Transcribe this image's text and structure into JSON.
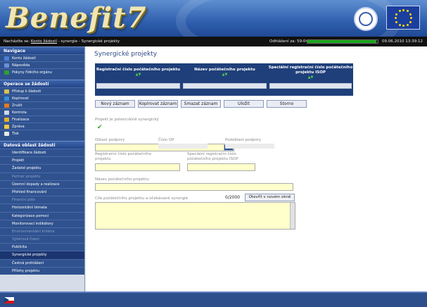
{
  "header": {
    "logo_text": "Benefit7",
    "breadcrumb_label": "Nacházíte se:",
    "breadcrumb_link": "Konto žádostí",
    "breadcrumb_rest": "- synergie - Synergické projekty",
    "timer_label": "Odhlášení za:",
    "timer_value": "59:04",
    "timer_progress": 0.98,
    "datetime": "09.06.2010 13:39:12"
  },
  "sidebar": {
    "sections": [
      {
        "title": "Navigace",
        "items": [
          {
            "label": "Konto žádostí",
            "icon": "list-icon",
            "color": "#4a7fd6"
          },
          {
            "label": "Nápověda",
            "icon": "help-icon",
            "color": "#6a8fd8"
          },
          {
            "label": "Pokyny řídicího orgánu",
            "icon": "info-icon",
            "color": "#2fa02f"
          }
        ]
      },
      {
        "title": "Operace se žádostí",
        "items": [
          {
            "label": "Přístup k žádosti",
            "icon": "key-icon",
            "color": "#d9c050"
          },
          {
            "label": "Kopírovat",
            "icon": "copy-icon",
            "color": "#3a8ad8"
          },
          {
            "label": "Zrušit",
            "icon": "cancel-icon",
            "color": "#e07a20"
          },
          {
            "label": "Kontrola",
            "icon": "check-icon",
            "color": "#cfd8ea"
          },
          {
            "label": "Finalizace",
            "icon": "lock-icon",
            "color": "#e0b030"
          },
          {
            "label": "Zpráva",
            "icon": "envelope-icon",
            "color": "#f0c840"
          },
          {
            "label": "Tisk",
            "icon": "print-icon",
            "color": "#e8e8e8"
          }
        ]
      },
      {
        "title": "Datová oblast žádosti",
        "details": [
          {
            "label": "Identifikace žádosti",
            "disabled": false,
            "active": false
          },
          {
            "label": "Projekt",
            "disabled": false,
            "active": false
          },
          {
            "label": "Žadatel projektu",
            "disabled": false,
            "active": false
          },
          {
            "label": "Partner projektu",
            "disabled": true,
            "active": false
          },
          {
            "label": "Územní dopady a realizace",
            "disabled": false,
            "active": false
          },
          {
            "label": "Přehled financování",
            "disabled": false,
            "active": false
          },
          {
            "label": "Finanční plán",
            "disabled": true,
            "active": false
          },
          {
            "label": "Horizontální témata",
            "disabled": false,
            "active": false
          },
          {
            "label": "Kategorizace pomoci",
            "disabled": false,
            "active": false
          },
          {
            "label": "Monitorovací indikátory",
            "disabled": false,
            "active": false
          },
          {
            "label": "Environmentální kritéria",
            "disabled": true,
            "active": false
          },
          {
            "label": "Výběrová řízení",
            "disabled": true,
            "active": false
          },
          {
            "label": "Publicita",
            "disabled": false,
            "active": false
          },
          {
            "label": "Synergické projekty",
            "disabled": false,
            "active": true
          },
          {
            "label": "Čestná prohlášení",
            "disabled": false,
            "active": false
          },
          {
            "label": "Přílohy projektu",
            "disabled": false,
            "active": false
          }
        ]
      }
    ]
  },
  "main": {
    "title": "Synergické projekty",
    "grid": {
      "columns": [
        "Registrační čísloюpočátečního projektu",
        "Název počátečního projektu",
        "Speciální registrační čísloпočátečního projektu ISOP"
      ]
    },
    "buttons": {
      "new": "Nový záznam",
      "copy": "Kopírovat záznam",
      "delete": "Smazat záznam",
      "save": "Uložit",
      "cancel": "Storno"
    },
    "form": {
      "potential_label": "Projekt je potenciálně synergický",
      "area_label": "Oblast podpory",
      "op_label": "Číslo OP",
      "subarea_label": "Podoblast podpory",
      "reg_label": "Registrační číslo počátečního projektu",
      "isop_label": "Speciální registrační číslo počátečního projektu ISOP",
      "name_label": "Název počátečního projektu",
      "goals_label": "Cíle počátečního projektu a očekávané synergie",
      "counter": "0/2000",
      "open_window": "Otevřít v novém okně"
    }
  }
}
